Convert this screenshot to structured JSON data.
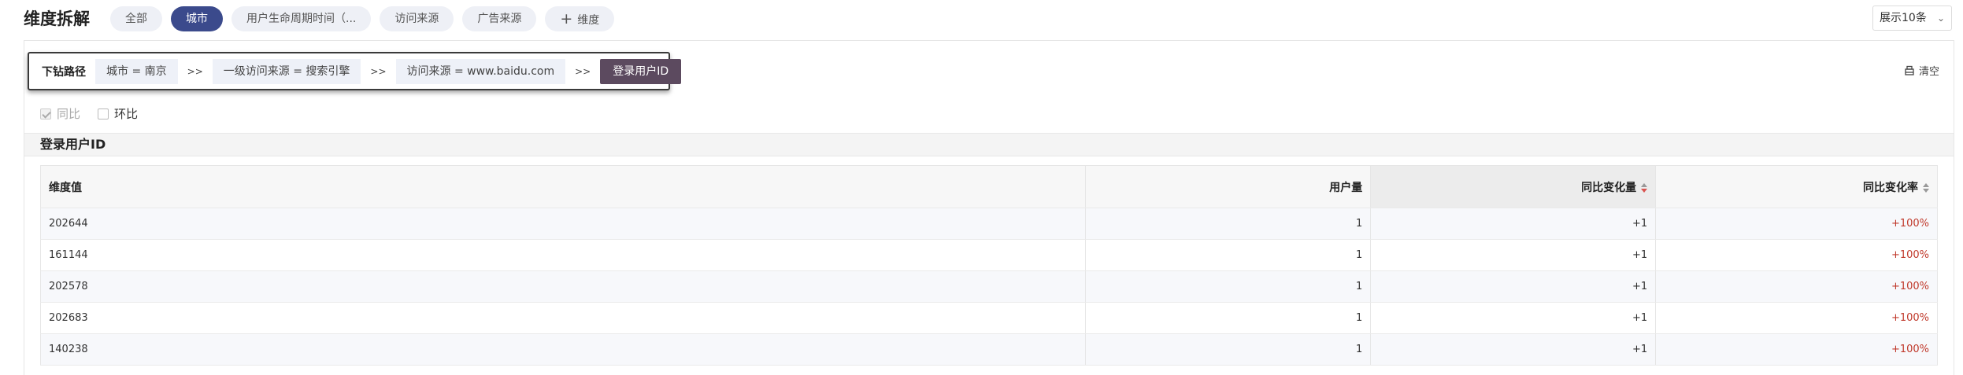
{
  "header": {
    "title": "维度拆解",
    "tabs": [
      {
        "label": "全部",
        "active": false
      },
      {
        "label": "城市",
        "active": true
      },
      {
        "label": "用户生命周期时间（...",
        "active": false
      },
      {
        "label": "访问来源",
        "active": false
      },
      {
        "label": "广告来源",
        "active": false
      }
    ],
    "add_dimension_label": "维度",
    "page_size": "展示10条"
  },
  "drill": {
    "label": "下钻路径",
    "crumbs": [
      "城市 = 南京",
      "一级访问来源 = 搜索引擎",
      "访问来源 = www.baidu.com"
    ],
    "separator": ">>",
    "current": "登录用户ID",
    "clear_label": "清空"
  },
  "compare": {
    "yoy_label": "同比",
    "mom_label": "环比"
  },
  "section": {
    "title": "登录用户ID"
  },
  "table": {
    "columns": [
      "维度值",
      "用户量",
      "同比变化量",
      "同比变化率"
    ],
    "rows": [
      [
        "202644",
        "1",
        "+1",
        "+100%"
      ],
      [
        "161144",
        "1",
        "+1",
        "+100%"
      ],
      [
        "202578",
        "1",
        "+1",
        "+100%"
      ],
      [
        "202683",
        "1",
        "+1",
        "+100%"
      ],
      [
        "140238",
        "1",
        "+1",
        "+100%"
      ]
    ]
  },
  "colors": {
    "accent": "#3b4a8c",
    "current_crumb": "#5c4a5f",
    "positive_rate": "#c0392b"
  }
}
